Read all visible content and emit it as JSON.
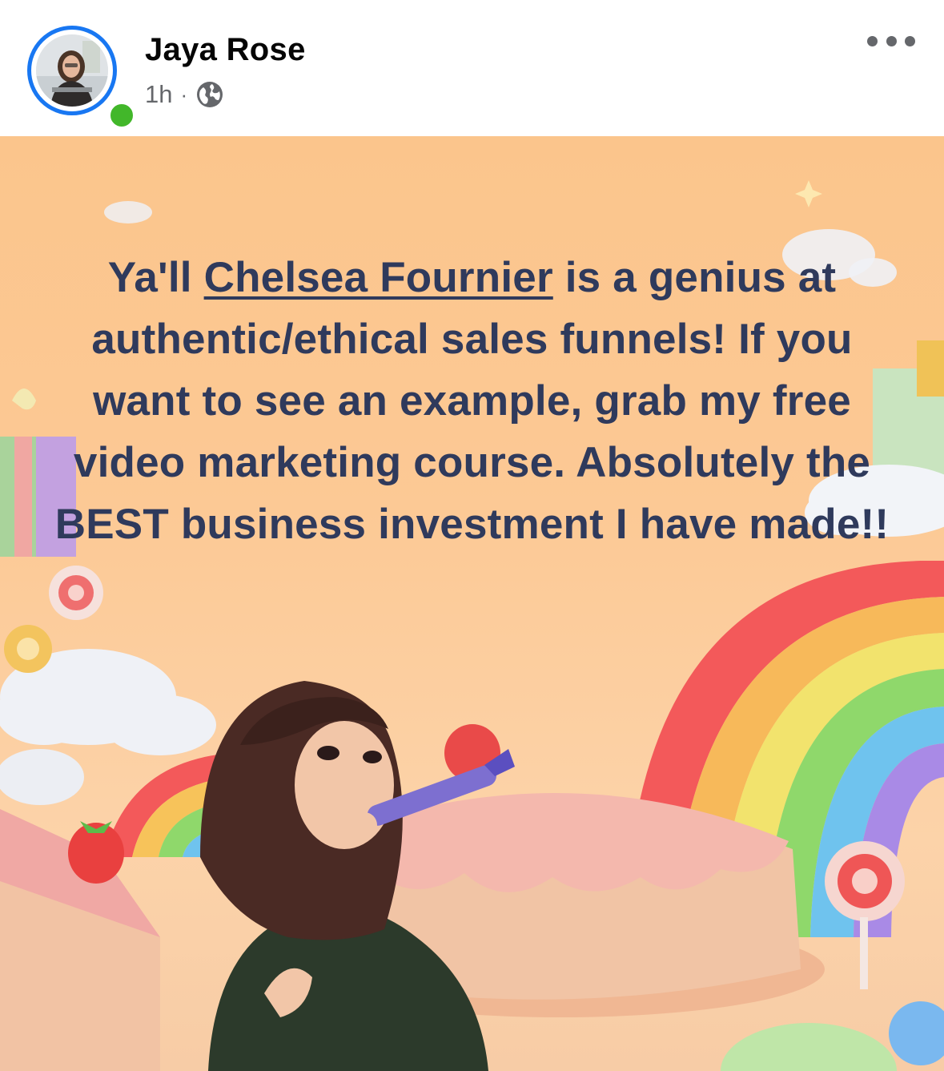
{
  "post": {
    "author": {
      "name": "Jaya Rose",
      "time": "1h",
      "separator": "·",
      "audience_icon": "globe-icon",
      "online": true
    },
    "menu_icon": "more-horizontal-icon",
    "text": {
      "before_mention": "Ya'll ",
      "mention": "Chelsea Fournier",
      "after_mention": " is a genius at authentic/ethical sales funnels! If you want to see an example, grab my free video marketing course. Absolutely the BEST business investment I have made!!"
    }
  },
  "colors": {
    "accent_ring": "#1877f2",
    "online": "#42b72a",
    "post_text": "#2f3a5c",
    "post_background": "#fbc58c"
  }
}
